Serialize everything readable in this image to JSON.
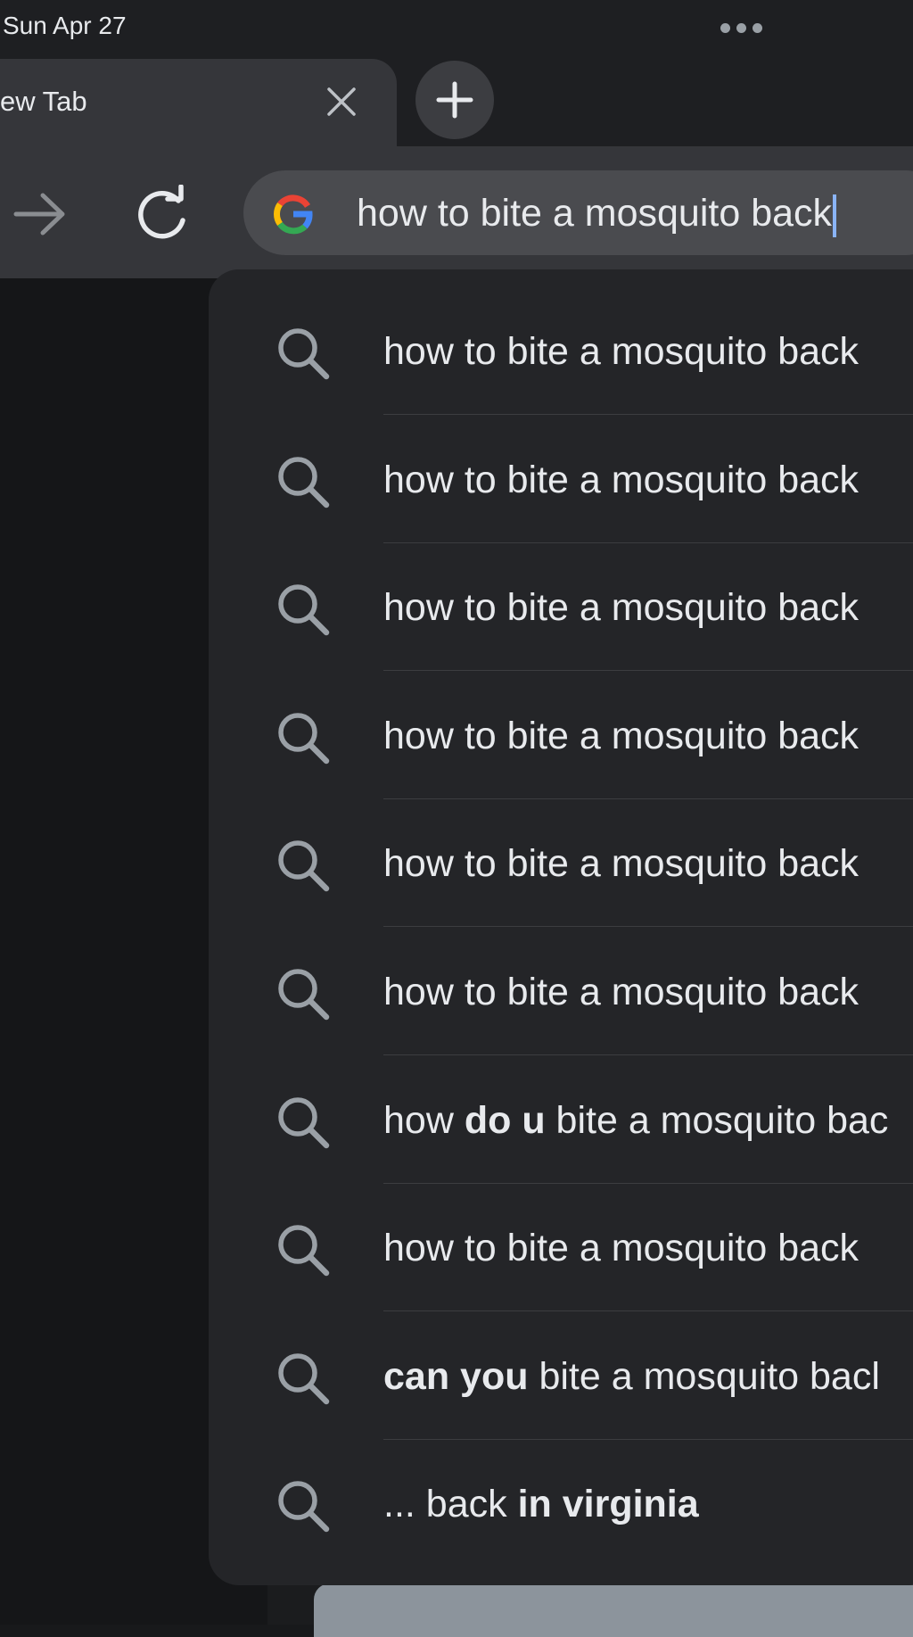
{
  "status_bar": {
    "date": "Sun Apr 27"
  },
  "tab": {
    "title": "ew Tab"
  },
  "omnibox": {
    "value": "how to bite a mosquito back"
  },
  "suggestions": [
    {
      "parts": [
        {
          "t": "how to bite a mosquito back",
          "b": false
        }
      ]
    },
    {
      "parts": [
        {
          "t": "how to bite a mosquito back",
          "b": false
        }
      ]
    },
    {
      "parts": [
        {
          "t": "how to bite a mosquito back",
          "b": false
        }
      ]
    },
    {
      "parts": [
        {
          "t": "how to bite a mosquito back",
          "b": false
        }
      ]
    },
    {
      "parts": [
        {
          "t": "how to bite a mosquito back",
          "b": false
        }
      ]
    },
    {
      "parts": [
        {
          "t": "how to bite a mosquito back",
          "b": false
        }
      ]
    },
    {
      "parts": [
        {
          "t": "how ",
          "b": false
        },
        {
          "t": "do u",
          "b": true
        },
        {
          "t": " bite a mosquito bac",
          "b": false
        }
      ]
    },
    {
      "parts": [
        {
          "t": "how to bite a mosquito back",
          "b": false
        }
      ]
    },
    {
      "parts": [
        {
          "t": "can you",
          "b": true
        },
        {
          "t": " bite a mosquito bacl",
          "b": false
        }
      ]
    },
    {
      "parts": [
        {
          "t": "... back ",
          "b": false
        },
        {
          "t": "in virginia",
          "b": true
        }
      ]
    }
  ],
  "icons": {
    "more": "more-dots-icon",
    "close": "close-icon",
    "new_tab": "plus-icon",
    "forward": "forward-arrow-icon",
    "reload": "reload-icon",
    "google": "google-logo-icon",
    "search": "search-icon"
  },
  "colors": {
    "accent": "#8ab4f8",
    "dropdown_bg": "#242528",
    "toolbar_bg": "#35363a"
  }
}
